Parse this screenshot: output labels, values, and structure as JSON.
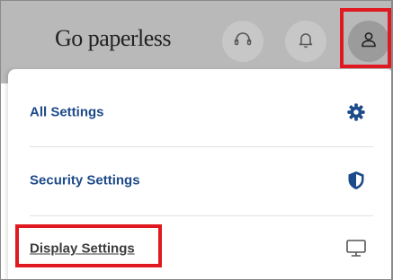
{
  "header": {
    "brand": "Go paperless",
    "icons": [
      "headset-icon",
      "bell-icon",
      "user-icon"
    ]
  },
  "menu": {
    "items": [
      {
        "label": "All Settings",
        "icon": "gear-icon"
      },
      {
        "label": "Security Settings",
        "icon": "shield-icon"
      },
      {
        "label": "Display Settings",
        "icon": "monitor-icon"
      }
    ]
  },
  "colors": {
    "header_bg": "#b9b9b9",
    "link_blue": "#1d4a8a",
    "highlight_red": "#e0181f"
  }
}
